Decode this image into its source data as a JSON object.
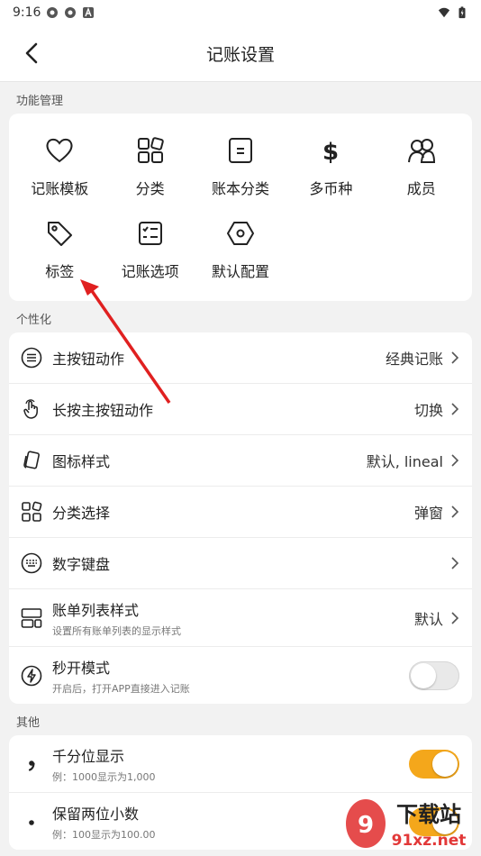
{
  "status": {
    "time": "9:16"
  },
  "header": {
    "title": "记账设置"
  },
  "sections": {
    "func": "功能管理",
    "personal": "个性化",
    "other": "其他"
  },
  "grid": [
    {
      "label": "记账模板",
      "icon": "heart-icon"
    },
    {
      "label": "分类",
      "icon": "category-icon"
    },
    {
      "label": "账本分类",
      "icon": "book-category-icon"
    },
    {
      "label": "多币种",
      "icon": "dollar-icon"
    },
    {
      "label": "成员",
      "icon": "members-icon"
    },
    {
      "label": "标签",
      "icon": "tag-icon"
    },
    {
      "label": "记账选项",
      "icon": "options-icon"
    },
    {
      "label": "默认配置",
      "icon": "hexagon-icon"
    }
  ],
  "personal": [
    {
      "label": "主按钮动作",
      "value": "经典记账",
      "icon": "list-circle-icon"
    },
    {
      "label": "长按主按钮动作",
      "value": "切换",
      "icon": "touch-icon"
    },
    {
      "label": "图标样式",
      "value": "默认, lineal",
      "icon": "icon-style-icon"
    },
    {
      "label": "分类选择",
      "value": "弹窗",
      "icon": "category-select-icon"
    },
    {
      "label": "数字键盘",
      "value": "",
      "icon": "keyboard-icon"
    },
    {
      "label": "账单列表样式",
      "sub": "设置所有账单列表的显示样式",
      "value": "默认",
      "icon": "list-style-icon"
    },
    {
      "label": "秒开模式",
      "sub": "开启后，打开APP直接进入记账",
      "icon": "lightning-icon",
      "toggle": false
    }
  ],
  "other": [
    {
      "label": "千分位显示",
      "sub": "例：1000显示为1,000",
      "icon": "comma-icon",
      "toggle": true
    },
    {
      "label": "保留两位小数",
      "sub": "例：100显示为100.00",
      "icon": "dot-icon",
      "toggle": true
    }
  ],
  "watermark": {
    "text": "下载站",
    "url": "91xz.net"
  },
  "colors": {
    "accent": "#f4a71b",
    "arrow": "#e02020"
  }
}
